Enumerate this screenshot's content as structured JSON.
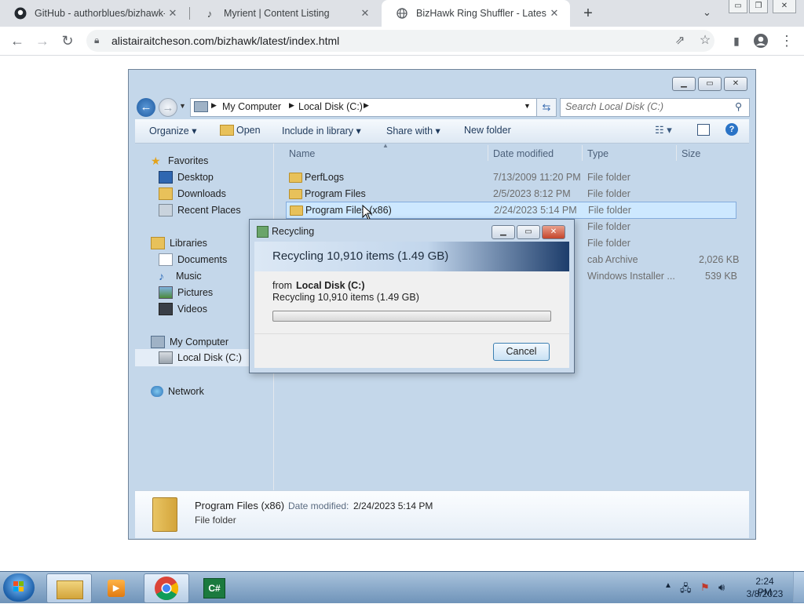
{
  "browser": {
    "tabs": [
      {
        "label": "GitHub - authorblues/bizhawk-sh",
        "icon": "github-icon"
      },
      {
        "label": "Myrient | Content Listing",
        "icon": "myrient-icon"
      },
      {
        "label": "BizHawk Ring Shuffler - Latest Bu",
        "icon": "globe-icon"
      }
    ],
    "new_tab": "+",
    "url": "alistairaitcheson.com/bizhawk/latest/index.html"
  },
  "explorer": {
    "breadcrumb": [
      "My Computer",
      "Local Disk (C:)"
    ],
    "search_placeholder": "Search Local Disk (C:)",
    "commands": [
      "Organize ▾",
      "Open",
      "Include in library ▾",
      "Share with ▾",
      "New folder"
    ],
    "nav": {
      "favorites": "Favorites",
      "favorites_items": [
        "Desktop",
        "Downloads",
        "Recent Places"
      ],
      "libraries": "Libraries",
      "libraries_items": [
        "Documents",
        "Music",
        "Pictures",
        "Videos"
      ],
      "computer": "My Computer",
      "computer_items": [
        "Local Disk (C:)"
      ],
      "network": "Network"
    },
    "columns": [
      "Name",
      "Date modified",
      "Type",
      "Size"
    ],
    "rows": [
      {
        "name": "PerfLogs",
        "date": "7/13/2009 11:20 PM",
        "type": "File folder",
        "size": ""
      },
      {
        "name": "Program Files",
        "date": "2/5/2023 8:12 PM",
        "type": "File folder",
        "size": ""
      },
      {
        "name": "Program Files (x86)",
        "date": "2/24/2023 5:14 PM",
        "type": "File folder",
        "size": ""
      },
      {
        "name": "",
        "date": "",
        "type": "File folder",
        "size": ""
      },
      {
        "name": "",
        "date": "",
        "type": "File folder",
        "size": ""
      },
      {
        "name": "",
        "date": "",
        "type": "cab Archive",
        "size": "2,026 KB"
      },
      {
        "name": "",
        "date": "",
        "type": "Windows Installer ...",
        "size": "539 KB"
      }
    ],
    "selected_row": 2,
    "details": {
      "name": "Program Files (x86)",
      "date_label": "Date modified:",
      "date": "2/24/2023 5:14 PM",
      "type": "File folder"
    }
  },
  "dialog": {
    "title": "Recycling",
    "heading": "Recycling 10,910 items (1.49 GB)",
    "from_label": "from",
    "from_value": "Local Disk (C:)",
    "status": "Recycling 10,910 items (1.49 GB)",
    "progress": 0,
    "cancel": "Cancel"
  },
  "taskbar": {
    "time": "2:24 PM",
    "date": "3/8/2023"
  },
  "colors": {
    "tabstrip": "#dee1e6",
    "selection": "#cde8ff",
    "dialog_banner": "#1d3d6b"
  }
}
